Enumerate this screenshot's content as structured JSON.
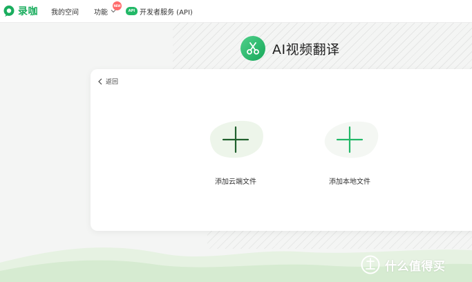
{
  "header": {
    "brand_name": "录咖",
    "nav": {
      "my_space": "我的空间",
      "features": "功能",
      "new_badge": "NEW",
      "api_icon_label": "API",
      "developer_service": "开发者服务 (API)"
    }
  },
  "page": {
    "title": "AI视频翻译",
    "back_label": "返回"
  },
  "upload": {
    "cloud_label": "添加云端文件",
    "local_label": "添加本地文件"
  },
  "watermark": {
    "text": "什么值得买",
    "icon": "zhi-icon"
  },
  "colors": {
    "brand_green": "#1aad5e",
    "plus_dark": "#1f5f2c",
    "plus_green": "#22b867",
    "badge_red": "#ff6b6b",
    "hill_green": "#dcefd8"
  },
  "icons": {
    "logo": "lucha-logo-icon",
    "chevron": "chevron-down-icon",
    "title": "scissors-icon",
    "back": "chevron-left-icon",
    "cloud_add": "plus-icon",
    "local_add": "plus-icon"
  }
}
